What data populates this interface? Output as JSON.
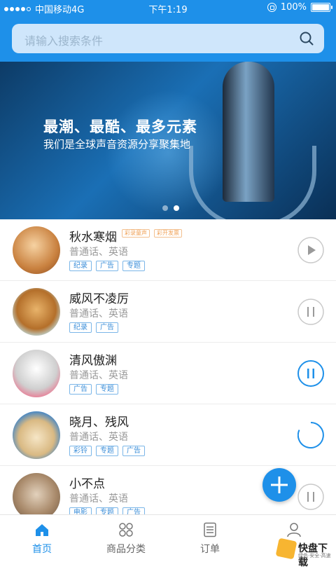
{
  "status_bar": {
    "carrier": "中国移动4G",
    "time": "下午1:19",
    "battery": "100%",
    "battery_level_percent": 100
  },
  "search": {
    "placeholder": "请输入搜索条件",
    "icon": "search-icon"
  },
  "banner": {
    "title": "最潮、最酷、最多元素",
    "subtitle": "我们是全球声音资源分享聚集地",
    "page_count": 2,
    "active_page": 2
  },
  "items": [
    {
      "name": "秋水寒烟",
      "lang": "普通话、英语",
      "badges": [
        "彩录童声",
        "彩开发票"
      ],
      "tags": [
        "纪录",
        "广告",
        "专题"
      ],
      "control": "play"
    },
    {
      "name": "威风不凌厉",
      "lang": "普通话、英语",
      "badges": [],
      "tags": [
        "纪录",
        "广告"
      ],
      "control": "pause"
    },
    {
      "name": "清风傲渊",
      "lang": "普通话、英语",
      "badges": [],
      "tags": [
        "广告",
        "专题"
      ],
      "control": "pause-active"
    },
    {
      "name": "晓月、残风",
      "lang": "普通话、英语",
      "badges": [],
      "tags": [
        "彩铃",
        "专题",
        "广告"
      ],
      "control": "loading"
    },
    {
      "name": "小不点",
      "lang": "普通话、英语",
      "badges": [],
      "tags": [
        "电影",
        "专题",
        "广告"
      ],
      "control": "pause"
    }
  ],
  "fab": {
    "icon": "plus-icon"
  },
  "tabs": [
    {
      "label": "首页",
      "icon": "home-icon",
      "active": true
    },
    {
      "label": "商品分类",
      "icon": "category-icon",
      "active": false
    },
    {
      "label": "订单",
      "icon": "order-icon",
      "active": false
    },
    {
      "label": "",
      "icon": "user-icon",
      "active": false
    }
  ],
  "watermark": {
    "title": "快盘下载",
    "sub": "绿色·安全·高速"
  },
  "colors": {
    "primary": "#1e90e9",
    "tag": "#3d8fd9",
    "badge": "#f0a35a"
  }
}
